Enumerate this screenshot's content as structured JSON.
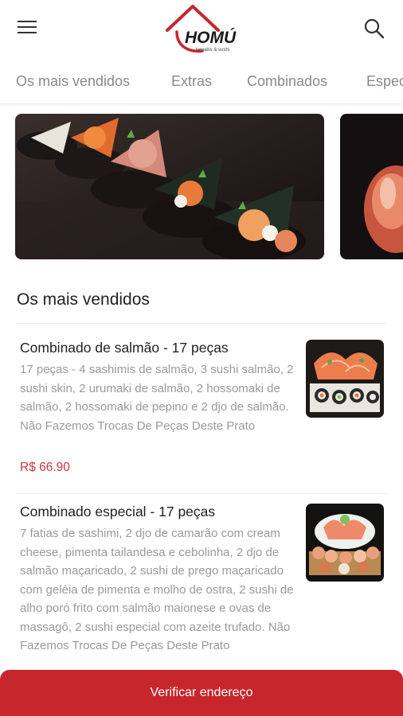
{
  "header": {
    "logo_text": "HOMÚ",
    "logo_subtext": "temakis & sushi",
    "brand_color": "#c8262d"
  },
  "tabs": [
    {
      "label": "Os mais vendidos"
    },
    {
      "label": "Extras"
    },
    {
      "label": "Combinados"
    },
    {
      "label": "Espec"
    }
  ],
  "section": {
    "title": "Os mais vendidos"
  },
  "items": [
    {
      "name": "Combinado de salmão - 17 peças",
      "description": "17 peças - 4 sashimis de salmão, 3 sushi salmão, 2 sushi skin, 2 urumaki de salmão, 2 hossomaki de salmão, 2 hossomaki de pepino e 2 djo de salmão. Não Fazemos Trocas De Peças Deste Prato",
      "price": "R$ 66.90"
    },
    {
      "name": "Combinado especial - 17 peças",
      "description": "7 fatias de sashimi, 2 djo de camarão com cream cheese, pimenta tailandesa e cebolinha, 2 djo de salmão maçaricado, 2 sushi de prego maçaricado com geléia de pimenta e molho de ostra, 2 sushi de alho poró frito com salmão maionese e ovas de massagô, 2 sushi especial com azeite trufado. Não Fazemos Trocas De Peças Deste Prato"
    }
  ],
  "bottom_button": {
    "label": "Verificar endereço"
  },
  "icons": {
    "menu": "hamburger-icon",
    "search": "search-icon"
  }
}
